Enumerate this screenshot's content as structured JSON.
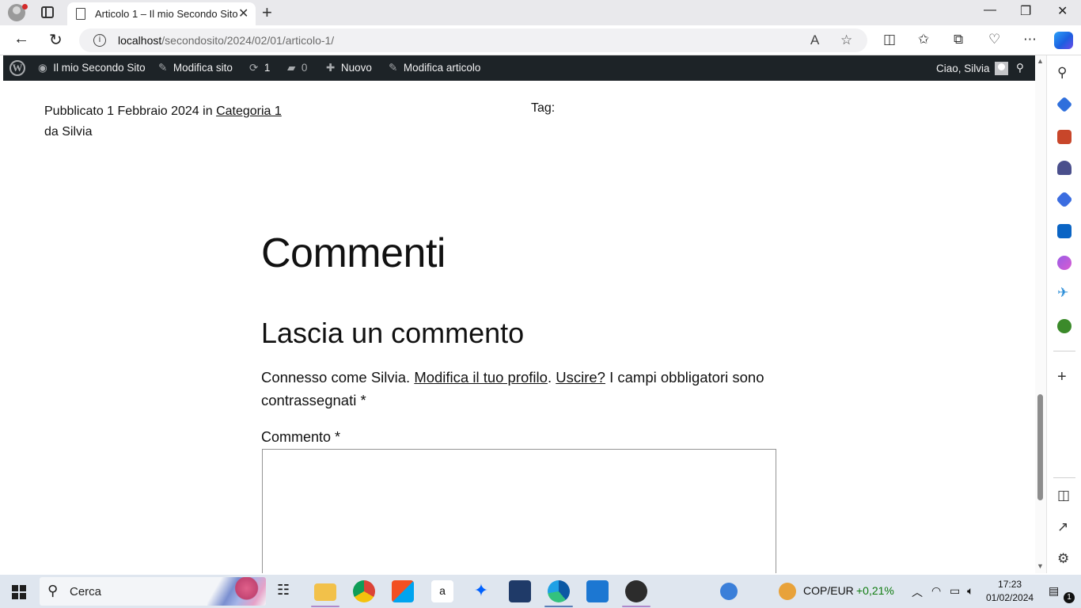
{
  "browser": {
    "tab_title": "Articolo 1 – Il mio Secondo Sito",
    "tab_close": "✕",
    "new_tab": "+",
    "url_host": "localhost",
    "url_path": "/secondosito/2024/02/01/articolo-1/",
    "window_controls": [
      "—",
      "❐",
      "✕"
    ]
  },
  "wp_admin_bar": {
    "site_name": "Il mio Secondo Sito",
    "edit_site": "Modifica sito",
    "updates_count": "1",
    "comments_count": "0",
    "new": "Nuovo",
    "edit_post": "Modifica articolo",
    "greeting": "Ciao, Silvia"
  },
  "post_meta": {
    "published_prefix": "Pubblicato",
    "date": "1 Febbraio 2024",
    "in": "in",
    "category": "Categoria 1",
    "by": "da Silvia",
    "tags_label": "Tag:"
  },
  "comments": {
    "heading": "Commenti",
    "reply_title": "Lascia un commento",
    "logged_in_prefix": "Connesso come Silvia.",
    "edit_profile": "Modifica il tuo profilo",
    "separator": ".",
    "logout": "Uscire?",
    "required_note": "I campi obbligatori sono contrassegnati *",
    "comment_label": "Commento *",
    "comment_value": ""
  },
  "taskbar": {
    "search_placeholder": "Cerca",
    "ticker_name": "COP/EUR",
    "ticker_change": "+0,21%",
    "ticker_color": "#0f7b0f",
    "time": "17:23",
    "date": "01/02/2024",
    "notification_count": "1"
  },
  "colors": {
    "wp_admin_bar": "#1d2327",
    "taskbar": "#dfe6ef",
    "browser_chrome": "#e9e9ec"
  }
}
